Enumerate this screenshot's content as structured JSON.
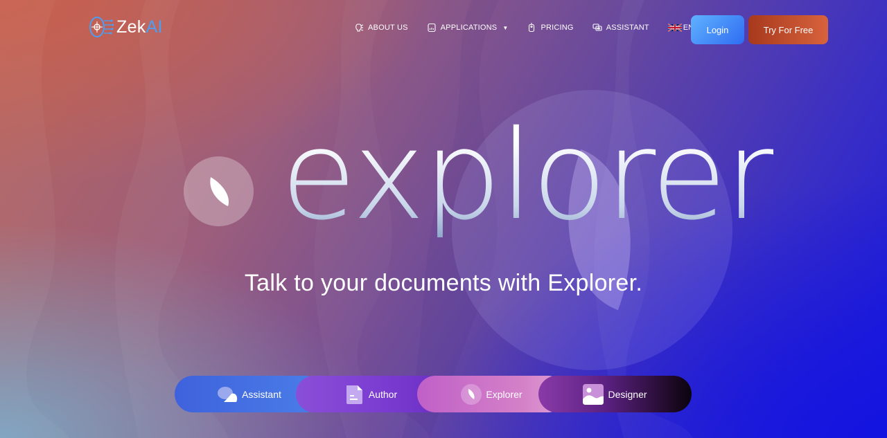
{
  "brand": {
    "name_prefix": "Zek",
    "name_suffix": "AI",
    "logo_icon": "brain-circuit-icon"
  },
  "nav": {
    "items": [
      {
        "label": "ABOUT US",
        "icon": "lightbulb-icon",
        "has_dropdown": false
      },
      {
        "label": "APPLICATIONS",
        "icon": "apps-icon",
        "has_dropdown": true
      },
      {
        "label": "PRICING",
        "icon": "price-tag-icon",
        "has_dropdown": false
      },
      {
        "label": "ASSISTANT",
        "icon": "chat-bubbles-icon",
        "has_dropdown": false
      }
    ],
    "language": {
      "code": "EN",
      "flag": "uk-flag-icon"
    },
    "login_label": "Login",
    "try_label": "Try For Free"
  },
  "hero": {
    "title": "explorer",
    "subtitle": "Talk to your documents with Explorer.",
    "badge_icon": "leaf-icon"
  },
  "switcher": {
    "items": [
      {
        "label": "Assistant",
        "icon": "chat-bubble-icon"
      },
      {
        "label": "Author",
        "icon": "document-icon"
      },
      {
        "label": "Explorer",
        "icon": "leaf-icon",
        "active": true
      },
      {
        "label": "Designer",
        "icon": "image-icon"
      }
    ]
  },
  "colors": {
    "brand_accent": "#4d9ef0",
    "login_bg": "#3f88f6",
    "try_bg": "#c0502d"
  }
}
